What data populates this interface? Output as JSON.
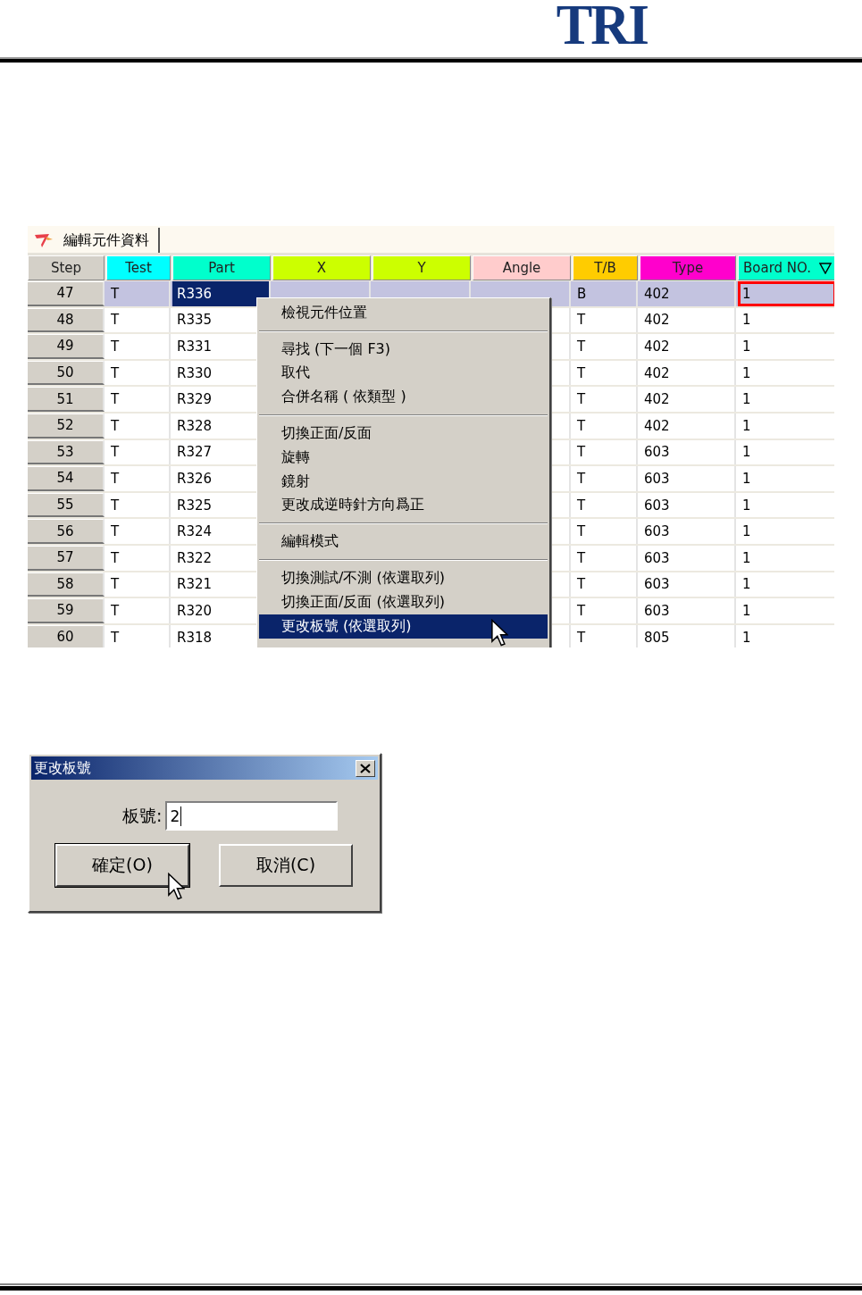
{
  "header": {
    "logo": "TRI"
  },
  "editor": {
    "tab": {
      "label": "編輯元件資料"
    },
    "columns": [
      {
        "kind": "step",
        "label": "Step",
        "color": "#d4d0c8"
      },
      {
        "kind": "test",
        "label": "Test",
        "color": "#00ffff"
      },
      {
        "kind": "part",
        "label": "Part",
        "color": "#00ffcc"
      },
      {
        "kind": "x",
        "label": "X",
        "color": "#ccff00"
      },
      {
        "kind": "y",
        "label": "Y",
        "color": "#ccff00"
      },
      {
        "kind": "angle",
        "label": "Angle",
        "color": "#ffcccc"
      },
      {
        "kind": "tb",
        "label": "T/B",
        "color": "#ffcc00"
      },
      {
        "kind": "type",
        "label": "Type",
        "color": "#ff00cc"
      },
      {
        "kind": "board",
        "label": "Board NO.",
        "color": "#00ffcc",
        "sorted": true
      }
    ],
    "rows": [
      {
        "step": "47",
        "test": "T",
        "part": "R336",
        "tb": "B",
        "type": "402",
        "board": "1",
        "selected": true,
        "part_focused": true,
        "board_outlined": true
      },
      {
        "step": "48",
        "test": "T",
        "part": "R335",
        "tb": "T",
        "type": "402",
        "board": "1",
        "selected": false,
        "part_focused": false,
        "board_outlined": false
      },
      {
        "step": "49",
        "test": "T",
        "part": "R331",
        "tb": "T",
        "type": "402",
        "board": "1",
        "selected": false,
        "part_focused": false,
        "board_outlined": false
      },
      {
        "step": "50",
        "test": "T",
        "part": "R330",
        "tb": "T",
        "type": "402",
        "board": "1",
        "selected": false,
        "part_focused": false,
        "board_outlined": false
      },
      {
        "step": "51",
        "test": "T",
        "part": "R329",
        "tb": "T",
        "type": "402",
        "board": "1",
        "selected": false,
        "part_focused": false,
        "board_outlined": false
      },
      {
        "step": "52",
        "test": "T",
        "part": "R328",
        "tb": "T",
        "type": "402",
        "board": "1",
        "selected": false,
        "part_focused": false,
        "board_outlined": false
      },
      {
        "step": "53",
        "test": "T",
        "part": "R327",
        "tb": "T",
        "type": "603",
        "board": "1",
        "selected": false,
        "part_focused": false,
        "board_outlined": false
      },
      {
        "step": "54",
        "test": "T",
        "part": "R326",
        "tb": "T",
        "type": "603",
        "board": "1",
        "selected": false,
        "part_focused": false,
        "board_outlined": false
      },
      {
        "step": "55",
        "test": "T",
        "part": "R325",
        "tb": "T",
        "type": "603",
        "board": "1",
        "selected": false,
        "part_focused": false,
        "board_outlined": false
      },
      {
        "step": "56",
        "test": "T",
        "part": "R324",
        "tb": "T",
        "type": "603",
        "board": "1",
        "selected": false,
        "part_focused": false,
        "board_outlined": false
      },
      {
        "step": "57",
        "test": "T",
        "part": "R322",
        "tb": "T",
        "type": "603",
        "board": "1",
        "selected": false,
        "part_focused": false,
        "board_outlined": false
      },
      {
        "step": "58",
        "test": "T",
        "part": "R321",
        "tb": "T",
        "type": "603",
        "board": "1",
        "selected": false,
        "part_focused": false,
        "board_outlined": false
      },
      {
        "step": "59",
        "test": "T",
        "part": "R320",
        "tb": "T",
        "type": "603",
        "board": "1",
        "selected": false,
        "part_focused": false,
        "board_outlined": false
      },
      {
        "step": "60",
        "test": "T",
        "part": "R318",
        "tb": "T",
        "type": "805",
        "board": "1",
        "selected": false,
        "part_focused": false,
        "board_outlined": false
      }
    ],
    "context_menu": {
      "groups": [
        [
          {
            "label": "檢視元件位置",
            "selected": false
          }
        ],
        [
          {
            "label": "尋找 (下一個  F3)",
            "selected": false
          },
          {
            "label": "取代",
            "selected": false
          },
          {
            "label": "合併名稱 ( 依類型 )",
            "selected": false
          }
        ],
        [
          {
            "label": "切換正面/反面",
            "selected": false
          },
          {
            "label": "旋轉",
            "selected": false
          },
          {
            "label": "鏡射",
            "selected": false
          },
          {
            "label": "更改成逆時針方向爲正",
            "selected": false
          }
        ],
        [
          {
            "label": "編輯模式",
            "selected": false
          }
        ],
        [
          {
            "label": "切換測試/不測 (依選取列)",
            "selected": false
          },
          {
            "label": "切換正面/反面 (依選取列)",
            "selected": false
          },
          {
            "label": "更改板號 (依選取列)",
            "selected": true
          }
        ]
      ]
    }
  },
  "dialog": {
    "title": "更改板號",
    "field_label": "板號:",
    "field_value": "2",
    "buttons": [
      {
        "label": "確定(O)",
        "default": true
      },
      {
        "label": "取消(C)",
        "default": false
      }
    ]
  }
}
